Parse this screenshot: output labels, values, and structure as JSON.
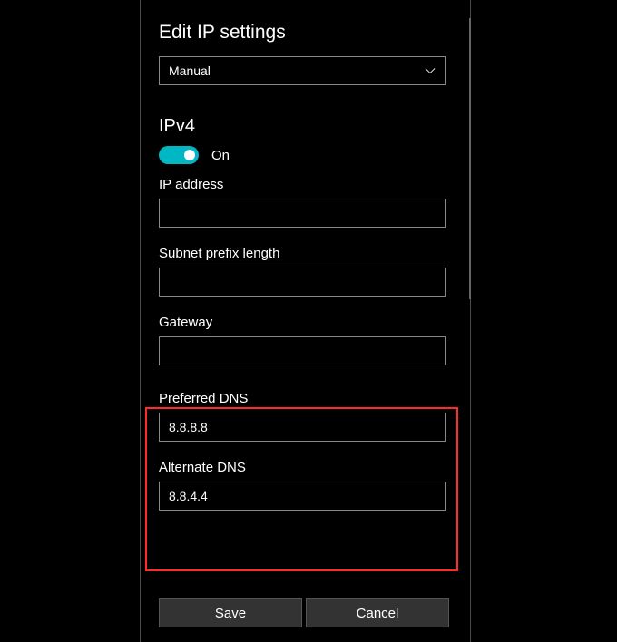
{
  "title": "Edit IP settings",
  "dropdown": {
    "selected": "Manual"
  },
  "ipv4": {
    "header": "IPv4",
    "toggleState": "On"
  },
  "fields": {
    "ipAddress": {
      "label": "IP address",
      "value": ""
    },
    "subnetPrefix": {
      "label": "Subnet prefix length",
      "value": ""
    },
    "gateway": {
      "label": "Gateway",
      "value": ""
    },
    "preferredDns": {
      "label": "Preferred DNS",
      "value": "8.8.8.8"
    },
    "alternateDns": {
      "label": "Alternate DNS",
      "value": "8.8.4.4"
    }
  },
  "buttons": {
    "save": "Save",
    "cancel": "Cancel"
  }
}
